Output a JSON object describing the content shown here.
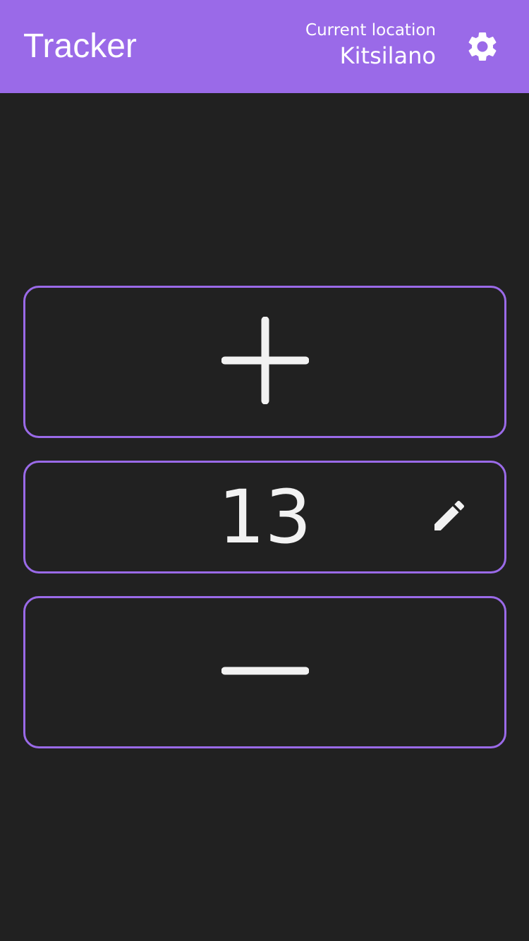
{
  "app_bar": {
    "title": "Tracker",
    "location_label": "Current location",
    "location_value": "Kitsilano",
    "settings_icon": "gear-icon"
  },
  "counter": {
    "increment_icon": "plus-icon",
    "value": "13",
    "edit_icon": "pencil-icon",
    "decrement_icon": "minus-icon"
  },
  "colors": {
    "accent": "#9a6ae8",
    "background": "#212121",
    "text": "#f2f2f2"
  }
}
